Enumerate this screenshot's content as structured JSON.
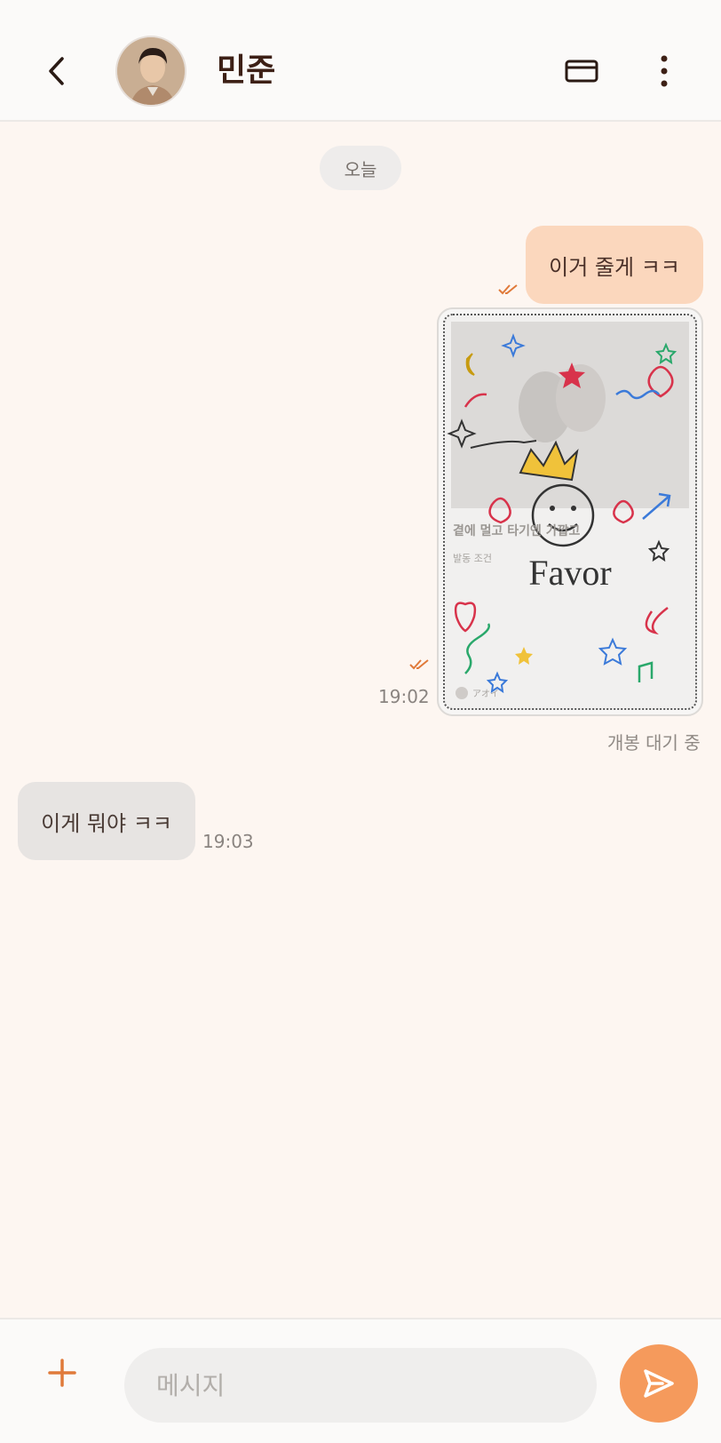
{
  "header": {
    "contact_name": "민준",
    "back_icon": "chevron-left-icon",
    "card_icon": "card-icon",
    "more_icon": "more-vertical-icon"
  },
  "date_chip": "오늘",
  "messages": [
    {
      "direction": "out",
      "text": "이거 줄게 ㅋㅋ",
      "read": true
    },
    {
      "direction": "out",
      "type": "gift",
      "gift_title": "Favor",
      "card_heading": "곁에 멀고 타기엔 가깝고",
      "card_sub": "발동 조건",
      "card_author": "アオイ",
      "time": "19:02",
      "status": "개봉 대기 중",
      "read": true
    },
    {
      "direction": "in",
      "text": "이게 뭐야 ㅋㅋ",
      "time": "19:03"
    }
  ],
  "composer": {
    "placeholder": "메시지",
    "plus_icon": "plus-icon",
    "send_icon": "send-icon"
  },
  "colors": {
    "accent": "#f59a5c",
    "outgoing_bubble": "#fbd7bd",
    "incoming_bubble": "#e7e4e2",
    "background": "#fdf6f1"
  }
}
